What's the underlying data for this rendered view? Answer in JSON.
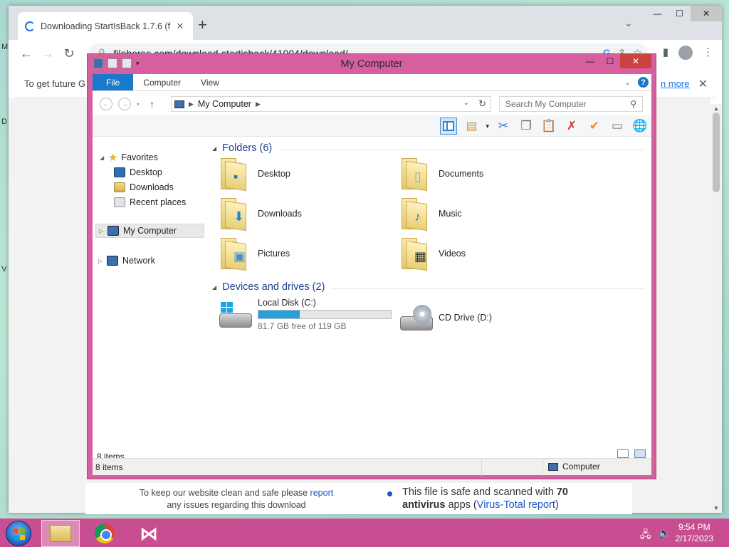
{
  "desktop": {
    "edge_letters": [
      "M",
      "D",
      "V"
    ]
  },
  "browser": {
    "tab_title": "Downloading StartIsBack 1.7.6 (f",
    "url": "filehorse.com/download-startisback/41004/download/",
    "infobar_text": "To get future G",
    "infobar_link": "n more",
    "report_text_1": "To keep our website clean and safe please ",
    "report_link": "report",
    "report_text_2": "any issues regarding this download",
    "safe_text_1": "This file is safe and scanned with ",
    "safe_count": "70",
    "safe_text_2": "antivirus",
    "safe_text_3": " apps (",
    "safe_link": "Virus-Total report",
    "safe_text_4": ")"
  },
  "explorer": {
    "title": "My Computer",
    "ribbon_tabs": [
      "File",
      "Computer",
      "View"
    ],
    "address_segment": "My Computer",
    "search_placeholder": "Search My Computer",
    "nav": {
      "favorites": "Favorites",
      "desktop": "Desktop",
      "downloads": "Downloads",
      "recent": "Recent places",
      "my_computer": "My Computer",
      "network": "Network"
    },
    "folders_header": "Folders (6)",
    "folders": [
      "Desktop",
      "Documents",
      "Downloads",
      "Music",
      "Pictures",
      "Videos"
    ],
    "devices_header": "Devices and drives (2)",
    "local_disk": {
      "name": "Local Disk (C:)",
      "free": "81.7 GB free of 119 GB",
      "used_fraction": 0.313
    },
    "cd_drive": "CD Drive (D:)",
    "item_count": "8 items",
    "status_items": "8 items",
    "status_location": "Computer"
  },
  "taskbar": {
    "time": "9:54 PM",
    "date": "2/17/2023"
  }
}
